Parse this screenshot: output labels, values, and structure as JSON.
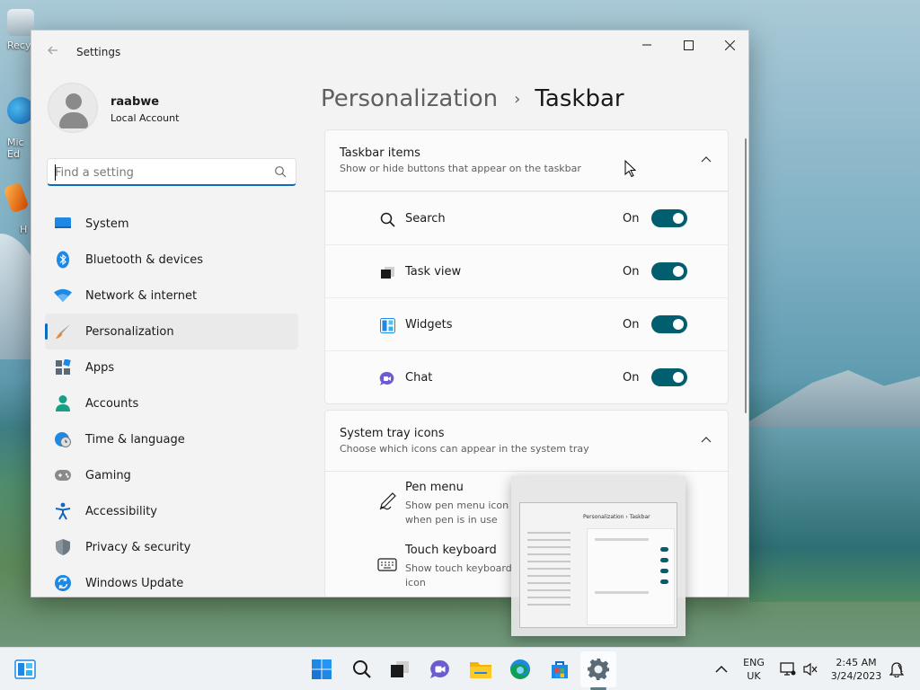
{
  "desktop": {
    "icons": [
      {
        "label": "Recy",
        "icon": "recycle-bin-icon",
        "color": "#cfd8dc"
      },
      {
        "label": "Mic Ed",
        "icon": "edge-shortcut-icon",
        "color": "#1e88e5"
      },
      {
        "label": "H",
        "icon": "app-shortcut-icon",
        "color": "#f57c00"
      }
    ]
  },
  "window": {
    "title": "Settings",
    "controls": {
      "minimize": "–",
      "maximize": "☐",
      "close": "✕"
    }
  },
  "account": {
    "name": "raabwe",
    "type": "Local Account"
  },
  "search": {
    "placeholder": "Find a setting"
  },
  "nav": {
    "items": [
      {
        "label": "System",
        "icon": "system-icon",
        "color": "#1e88e5"
      },
      {
        "label": "Bluetooth & devices",
        "icon": "bluetooth-icon",
        "color": "#1e88e5"
      },
      {
        "label": "Network & internet",
        "icon": "wifi-icon",
        "color": "#1e88e5"
      },
      {
        "label": "Personalization",
        "icon": "brush-icon",
        "color": "#e08b3c",
        "selected": true
      },
      {
        "label": "Apps",
        "icon": "apps-icon",
        "color": "#5b6a75"
      },
      {
        "label": "Accounts",
        "icon": "accounts-icon",
        "color": "#16a085"
      },
      {
        "label": "Time & language",
        "icon": "globe-clock-icon",
        "color": "#1e88e5"
      },
      {
        "label": "Gaming",
        "icon": "gamepad-icon",
        "color": "#7a7a7a"
      },
      {
        "label": "Accessibility",
        "icon": "accessibility-icon",
        "color": "#1565c0"
      },
      {
        "label": "Privacy & security",
        "icon": "shield-icon",
        "color": "#6d7a82"
      },
      {
        "label": "Windows Update",
        "icon": "update-icon",
        "color": "#1e88e5"
      }
    ]
  },
  "breadcrumb": {
    "parent": "Personalization",
    "separator": "›",
    "current": "Taskbar"
  },
  "taskbar_items": {
    "title": "Taskbar items",
    "description": "Show or hide buttons that appear on the taskbar",
    "rows": [
      {
        "label": "Search",
        "state": "On",
        "icon": "search-icon"
      },
      {
        "label": "Task view",
        "state": "On",
        "icon": "task-view-icon"
      },
      {
        "label": "Widgets",
        "state": "On",
        "icon": "widgets-icon"
      },
      {
        "label": "Chat",
        "state": "On",
        "icon": "chat-icon"
      }
    ]
  },
  "system_tray": {
    "title": "System tray icons",
    "description": "Choose which icons can appear in the system tray",
    "rows": [
      {
        "title": "Pen menu",
        "description": "Show pen menu icon when pen is in use",
        "icon": "pen-icon"
      },
      {
        "title": "Touch keyboard",
        "description": "Show touch keyboard icon",
        "icon": "keyboard-icon"
      }
    ]
  },
  "thumbnail": {
    "header": "Personalization › Taskbar"
  },
  "os_taskbar": {
    "apps": [
      {
        "name": "start",
        "icon": "windows-start-icon"
      },
      {
        "name": "search",
        "icon": "taskbar-search-icon"
      },
      {
        "name": "task-view",
        "icon": "taskbar-task-view-icon"
      },
      {
        "name": "chat",
        "icon": "taskbar-chat-icon"
      },
      {
        "name": "file-explorer",
        "icon": "folder-icon"
      },
      {
        "name": "edge",
        "icon": "edge-icon"
      },
      {
        "name": "store",
        "icon": "store-icon"
      },
      {
        "name": "settings",
        "icon": "gear-icon",
        "active": true
      }
    ],
    "language_line1": "ENG",
    "language_line2": "UK",
    "time": "2:45 AM",
    "date": "3/24/2023"
  }
}
